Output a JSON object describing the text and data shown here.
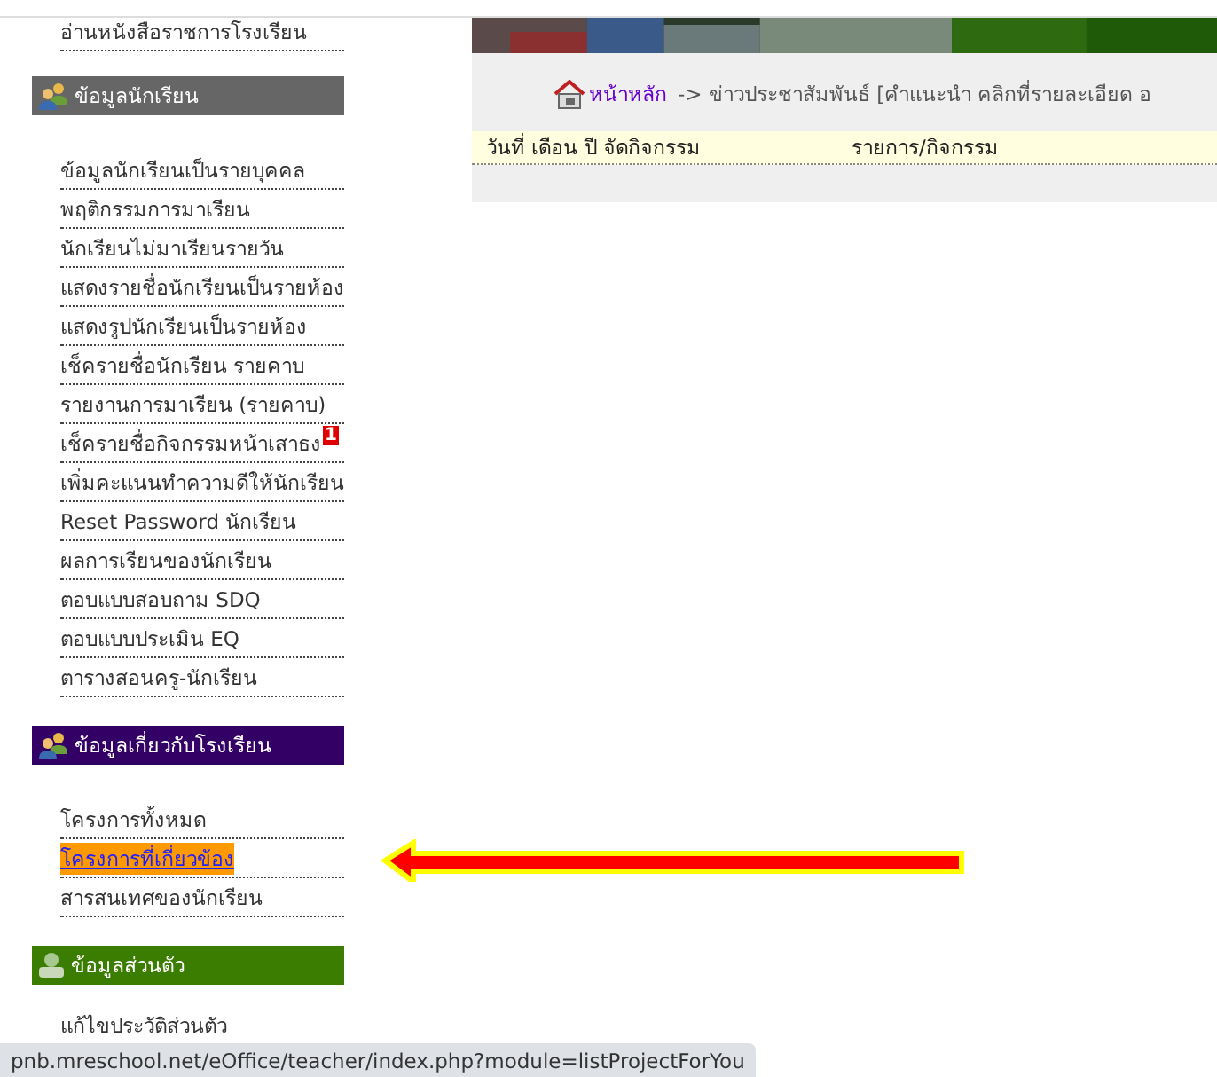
{
  "sidebar": {
    "sections": [
      {
        "kind": "plain",
        "items": [
          {
            "label": "อ่านหนังสือราชการโรงเรียน",
            "selected": false
          }
        ]
      },
      {
        "title": "ข้อมูลนักเรียน",
        "kind": "students",
        "color": "#666666",
        "items": [
          {
            "label": "ข้อมูลนักเรียนเป็นรายบุคคล",
            "selected": false
          },
          {
            "label": "พฤติกรรมการมาเรียน",
            "selected": false
          },
          {
            "label": "นักเรียนไม่มาเรียนรายวัน",
            "selected": false
          },
          {
            "label": "แสดงรายชื่อนักเรียนเป็นรายห้อง",
            "selected": false
          },
          {
            "label": "แสดงรูปนักเรียนเป็นรายห้อง",
            "selected": false
          },
          {
            "label": "เช็ครายชื่อนักเรียน รายคาบ",
            "selected": false
          },
          {
            "label": "รายงานการมาเรียน (รายคาบ)",
            "selected": false
          },
          {
            "label": "เช็ครายชื่อกิจกรรมหน้าเสาธง",
            "selected": false,
            "badge": "1"
          },
          {
            "label": "เพิ่มคะแนนทำความดีให้นักเรียน",
            "selected": false
          },
          {
            "label": "Reset Password นักเรียน",
            "selected": false
          },
          {
            "label": "ผลการเรียนของนักเรียน",
            "selected": false
          },
          {
            "label": "ตอบแบบสอบถาม SDQ",
            "selected": false
          },
          {
            "label": "ตอบแบบประเมิน EQ",
            "selected": false
          },
          {
            "label": "ตารางสอนครู-นักเรียน",
            "selected": false
          }
        ]
      },
      {
        "title": "ข้อมูลเกี่ยวกับโรงเรียน",
        "kind": "students",
        "color": "#330066",
        "items": [
          {
            "label": "โครงการทั้งหมด",
            "selected": false
          },
          {
            "label": "โครงการที่เกี่ยวข้อง",
            "selected": true
          },
          {
            "label": "สารสนเทศของนักเรียน",
            "selected": false
          }
        ]
      },
      {
        "title": "ข้อมูลส่วนตัว",
        "kind": "person",
        "color": "#3a7d00",
        "items": [
          {
            "label": "แก้ไขประวัติส่วนตัว",
            "selected": false
          }
        ]
      }
    ]
  },
  "breadcrumb": {
    "home": "หน้าหลัก",
    "path": "-> ข่าวประชาสัมพันธ์ [คำแนะนำ คลิกที่รายละเอียด อ"
  },
  "table": {
    "columns": [
      "วันที่ เดือน ปี จัดกิจกรรม",
      "รายการ/กิจกรรม"
    ]
  },
  "status_bar": "pnb.mreschool.net/eOffice/teacher/index.php?module=listProjectForYou"
}
